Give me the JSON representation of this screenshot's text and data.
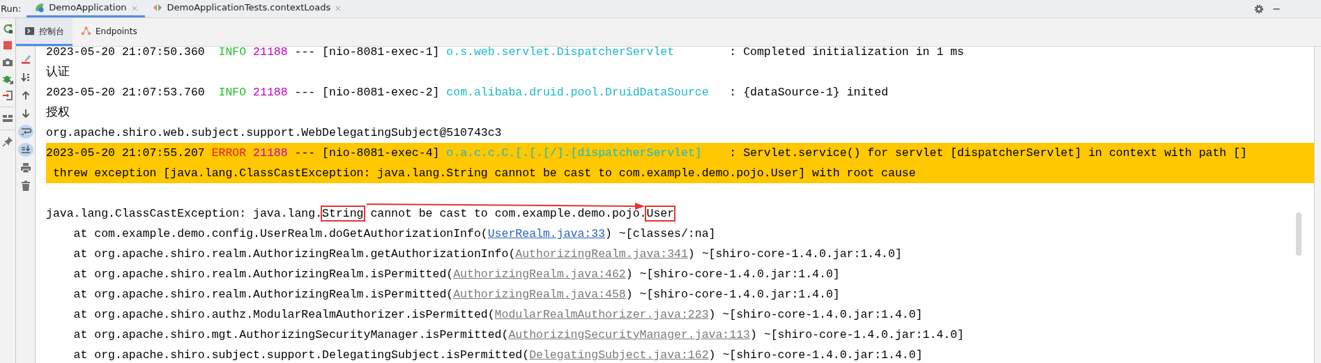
{
  "run_label": "Run:",
  "run_tabs": [
    {
      "label": "DemoApplication",
      "selected": true
    },
    {
      "label": "DemoApplicationTests.contextLoads",
      "selected": false
    }
  ],
  "console_tabs": [
    {
      "label": "控制台",
      "selected": true
    },
    {
      "label": "Endpoints",
      "selected": false
    }
  ],
  "console_tools": [
    {
      "selected": false
    },
    {
      "selected": false
    },
    {
      "selected": false
    },
    {
      "selected": false
    },
    {
      "selected": true
    },
    {
      "selected": true
    },
    {
      "selected": false
    },
    {
      "selected": false
    }
  ],
  "console": {
    "lines": [
      {
        "highlighted": false,
        "segments": [
          {
            "text": "2023-05-20 21:07:50.360",
            "kind": "plain"
          },
          {
            "text": "  INFO",
            "kind": "info"
          },
          {
            "text": " 21188",
            "kind": "pid"
          },
          {
            "text": " --- [nio-8081-exec-1]",
            "kind": "plain"
          },
          {
            "text": " o.s.web.servlet.DispatcherServlet",
            "kind": "logger"
          },
          {
            "text": "        : Completed initialization in 1 ms",
            "kind": "plain"
          }
        ]
      },
      {
        "highlighted": false,
        "segments": [
          {
            "text": "认证",
            "kind": "plain"
          }
        ]
      },
      {
        "highlighted": false,
        "segments": [
          {
            "text": "2023-05-20 21:07:53.760",
            "kind": "plain"
          },
          {
            "text": "  INFO",
            "kind": "info"
          },
          {
            "text": " 21188",
            "kind": "pid"
          },
          {
            "text": " --- [nio-8081-exec-2]",
            "kind": "plain"
          },
          {
            "text": " com.alibaba.druid.pool.DruidDataSource",
            "kind": "logger"
          },
          {
            "text": "   : {dataSource-1} inited",
            "kind": "plain"
          }
        ]
      },
      {
        "highlighted": false,
        "segments": [
          {
            "text": "授权",
            "kind": "plain"
          }
        ]
      },
      {
        "highlighted": false,
        "segments": [
          {
            "text": "org.apache.shiro.web.subject.support.WebDelegatingSubject@510743c3",
            "kind": "plain"
          }
        ]
      },
      {
        "highlighted": true,
        "segments": [
          {
            "text": "2023-05-20 21:07:55.207",
            "kind": "plain"
          },
          {
            "text": " ERROR",
            "kind": "error"
          },
          {
            "text": " 21188",
            "kind": "pid"
          },
          {
            "text": " --- [nio-8081-exec-4]",
            "kind": "plain"
          },
          {
            "text": " o.a.c.c.C.[.[.[/].[dispatcherServlet]",
            "kind": "logger"
          },
          {
            "text": "    : Servlet.service() for servlet [dispatcherServlet] in context with path []",
            "kind": "plain"
          }
        ]
      },
      {
        "highlighted": true,
        "segments": [
          {
            "text": " threw exception [java.lang.ClassCastException: java.lang.String cannot be cast to com.example.demo.pojo.User] with root cause",
            "kind": "plain"
          }
        ]
      },
      {
        "highlighted": false
      },
      {
        "highlighted": false,
        "segments": [
          {
            "text": "java.lang.ClassCastException: java.lang.",
            "kind": "plain"
          },
          {
            "text": "String",
            "kind": "plain",
            "boxed": true
          },
          {
            "text": " cannot be cast to com.example.demo.pojo.",
            "kind": "plain"
          },
          {
            "text": "User",
            "kind": "plain",
            "boxed": true
          }
        ]
      },
      {
        "highlighted": false,
        "segments": [
          {
            "text": "    at com.example.demo.config.UserRealm.doGetAuthorizationInfo(",
            "kind": "plain"
          },
          {
            "text": "UserRealm.java:33",
            "kind": "link"
          },
          {
            "text": ") ~[classes/:na]",
            "kind": "plain"
          }
        ]
      },
      {
        "highlighted": false,
        "segments": [
          {
            "text": "    at org.apache.shiro.realm.AuthorizingRealm.getAuthorizationInfo(",
            "kind": "plain"
          },
          {
            "text": "AuthorizingRealm.java:341",
            "kind": "lib_link"
          },
          {
            "text": ") ~[shiro-core-1.4.0.jar:1.4.0]",
            "kind": "plain"
          }
        ]
      },
      {
        "highlighted": false,
        "segments": [
          {
            "text": "    at org.apache.shiro.realm.AuthorizingRealm.isPermitted(",
            "kind": "plain"
          },
          {
            "text": "AuthorizingRealm.java:462",
            "kind": "lib_link"
          },
          {
            "text": ") ~[shiro-core-1.4.0.jar:1.4.0]",
            "kind": "plain"
          }
        ]
      },
      {
        "highlighted": false,
        "segments": [
          {
            "text": "    at org.apache.shiro.realm.AuthorizingRealm.isPermitted(",
            "kind": "plain"
          },
          {
            "text": "AuthorizingRealm.java:458",
            "kind": "lib_link"
          },
          {
            "text": ") ~[shiro-core-1.4.0.jar:1.4.0]",
            "kind": "plain"
          }
        ]
      },
      {
        "highlighted": false,
        "segments": [
          {
            "text": "    at org.apache.shiro.authz.ModularRealmAuthorizer.isPermitted(",
            "kind": "plain"
          },
          {
            "text": "ModularRealmAuthorizer.java:223",
            "kind": "lib_link"
          },
          {
            "text": ") ~[shiro-core-1.4.0.jar:1.4.0]",
            "kind": "plain"
          }
        ]
      },
      {
        "highlighted": false,
        "segments": [
          {
            "text": "    at org.apache.shiro.mgt.AuthorizingSecurityManager.isPermitted(",
            "kind": "plain"
          },
          {
            "text": "AuthorizingSecurityManager.java:113",
            "kind": "lib_link"
          },
          {
            "text": ") ~[shiro-core-1.4.0.jar:1.4.0]",
            "kind": "plain"
          }
        ]
      },
      {
        "highlighted": false,
        "segments": [
          {
            "text": "    at org.apache.shiro.subject.support.DelegatingSubject.isPermitted(",
            "kind": "plain"
          },
          {
            "text": "DelegatingSubject.java:162",
            "kind": "lib_link"
          },
          {
            "text": ") ~[shiro-core-1.4.0.jar:1.4.0]",
            "kind": "plain"
          }
        ]
      }
    ]
  }
}
